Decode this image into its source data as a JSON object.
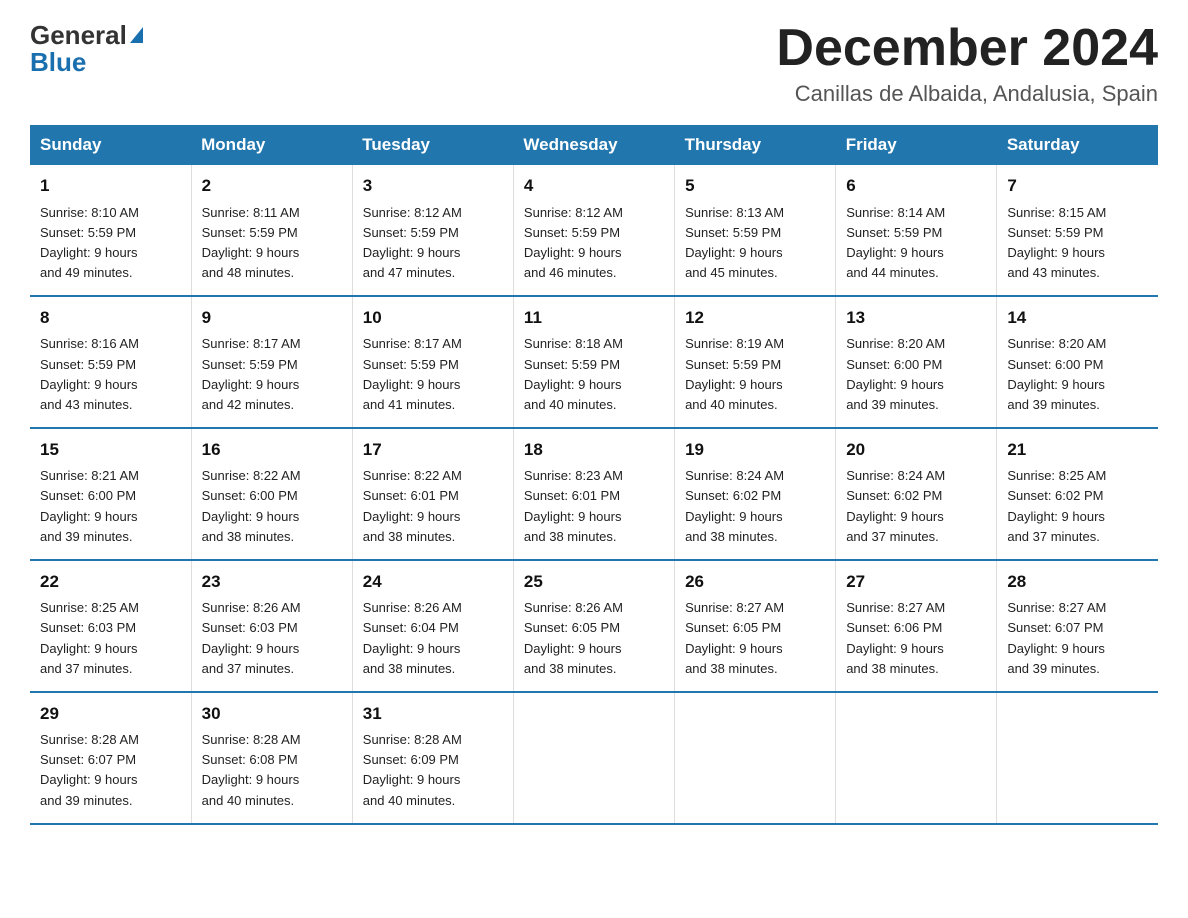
{
  "header": {
    "logo_general": "General",
    "logo_blue": "Blue",
    "month_title": "December 2024",
    "location": "Canillas de Albaida, Andalusia, Spain"
  },
  "days_of_week": [
    "Sunday",
    "Monday",
    "Tuesday",
    "Wednesday",
    "Thursday",
    "Friday",
    "Saturday"
  ],
  "weeks": [
    [
      {
        "day": "1",
        "sunrise": "8:10 AM",
        "sunset": "5:59 PM",
        "daylight": "9 hours and 49 minutes."
      },
      {
        "day": "2",
        "sunrise": "8:11 AM",
        "sunset": "5:59 PM",
        "daylight": "9 hours and 48 minutes."
      },
      {
        "day": "3",
        "sunrise": "8:12 AM",
        "sunset": "5:59 PM",
        "daylight": "9 hours and 47 minutes."
      },
      {
        "day": "4",
        "sunrise": "8:12 AM",
        "sunset": "5:59 PM",
        "daylight": "9 hours and 46 minutes."
      },
      {
        "day": "5",
        "sunrise": "8:13 AM",
        "sunset": "5:59 PM",
        "daylight": "9 hours and 45 minutes."
      },
      {
        "day": "6",
        "sunrise": "8:14 AM",
        "sunset": "5:59 PM",
        "daylight": "9 hours and 44 minutes."
      },
      {
        "day": "7",
        "sunrise": "8:15 AM",
        "sunset": "5:59 PM",
        "daylight": "9 hours and 43 minutes."
      }
    ],
    [
      {
        "day": "8",
        "sunrise": "8:16 AM",
        "sunset": "5:59 PM",
        "daylight": "9 hours and 43 minutes."
      },
      {
        "day": "9",
        "sunrise": "8:17 AM",
        "sunset": "5:59 PM",
        "daylight": "9 hours and 42 minutes."
      },
      {
        "day": "10",
        "sunrise": "8:17 AM",
        "sunset": "5:59 PM",
        "daylight": "9 hours and 41 minutes."
      },
      {
        "day": "11",
        "sunrise": "8:18 AM",
        "sunset": "5:59 PM",
        "daylight": "9 hours and 40 minutes."
      },
      {
        "day": "12",
        "sunrise": "8:19 AM",
        "sunset": "5:59 PM",
        "daylight": "9 hours and 40 minutes."
      },
      {
        "day": "13",
        "sunrise": "8:20 AM",
        "sunset": "6:00 PM",
        "daylight": "9 hours and 39 minutes."
      },
      {
        "day": "14",
        "sunrise": "8:20 AM",
        "sunset": "6:00 PM",
        "daylight": "9 hours and 39 minutes."
      }
    ],
    [
      {
        "day": "15",
        "sunrise": "8:21 AM",
        "sunset": "6:00 PM",
        "daylight": "9 hours and 39 minutes."
      },
      {
        "day": "16",
        "sunrise": "8:22 AM",
        "sunset": "6:00 PM",
        "daylight": "9 hours and 38 minutes."
      },
      {
        "day": "17",
        "sunrise": "8:22 AM",
        "sunset": "6:01 PM",
        "daylight": "9 hours and 38 minutes."
      },
      {
        "day": "18",
        "sunrise": "8:23 AM",
        "sunset": "6:01 PM",
        "daylight": "9 hours and 38 minutes."
      },
      {
        "day": "19",
        "sunrise": "8:24 AM",
        "sunset": "6:02 PM",
        "daylight": "9 hours and 38 minutes."
      },
      {
        "day": "20",
        "sunrise": "8:24 AM",
        "sunset": "6:02 PM",
        "daylight": "9 hours and 37 minutes."
      },
      {
        "day": "21",
        "sunrise": "8:25 AM",
        "sunset": "6:02 PM",
        "daylight": "9 hours and 37 minutes."
      }
    ],
    [
      {
        "day": "22",
        "sunrise": "8:25 AM",
        "sunset": "6:03 PM",
        "daylight": "9 hours and 37 minutes."
      },
      {
        "day": "23",
        "sunrise": "8:26 AM",
        "sunset": "6:03 PM",
        "daylight": "9 hours and 37 minutes."
      },
      {
        "day": "24",
        "sunrise": "8:26 AM",
        "sunset": "6:04 PM",
        "daylight": "9 hours and 38 minutes."
      },
      {
        "day": "25",
        "sunrise": "8:26 AM",
        "sunset": "6:05 PM",
        "daylight": "9 hours and 38 minutes."
      },
      {
        "day": "26",
        "sunrise": "8:27 AM",
        "sunset": "6:05 PM",
        "daylight": "9 hours and 38 minutes."
      },
      {
        "day": "27",
        "sunrise": "8:27 AM",
        "sunset": "6:06 PM",
        "daylight": "9 hours and 38 minutes."
      },
      {
        "day": "28",
        "sunrise": "8:27 AM",
        "sunset": "6:07 PM",
        "daylight": "9 hours and 39 minutes."
      }
    ],
    [
      {
        "day": "29",
        "sunrise": "8:28 AM",
        "sunset": "6:07 PM",
        "daylight": "9 hours and 39 minutes."
      },
      {
        "day": "30",
        "sunrise": "8:28 AM",
        "sunset": "6:08 PM",
        "daylight": "9 hours and 40 minutes."
      },
      {
        "day": "31",
        "sunrise": "8:28 AM",
        "sunset": "6:09 PM",
        "daylight": "9 hours and 40 minutes."
      },
      null,
      null,
      null,
      null
    ]
  ],
  "labels": {
    "sunrise": "Sunrise:",
    "sunset": "Sunset:",
    "daylight": "Daylight:"
  }
}
